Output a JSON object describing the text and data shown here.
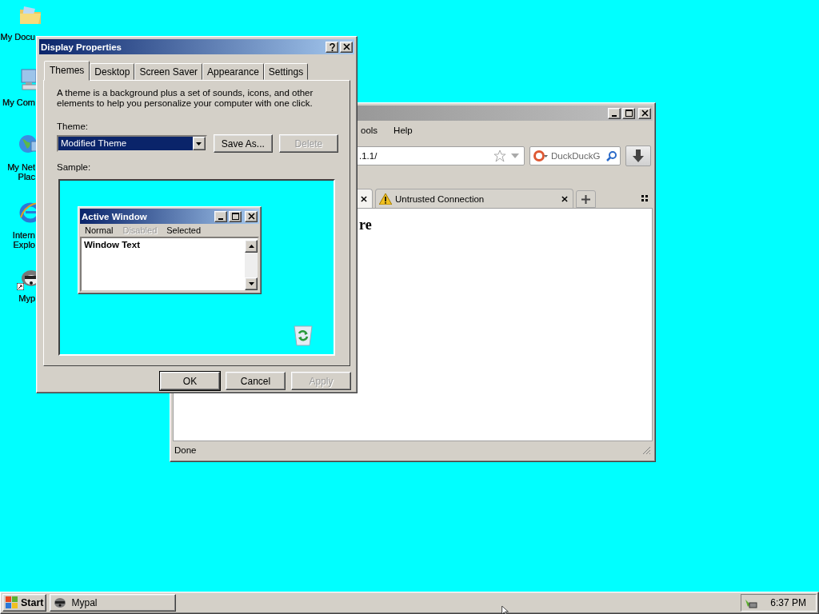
{
  "desktop": {
    "icons": [
      {
        "kind": "folder",
        "lines": [
          "My Docu"
        ]
      },
      {
        "kind": "computer",
        "lines": [
          "My Com"
        ]
      },
      {
        "kind": "network",
        "lines": [
          "My Net",
          "Plac"
        ]
      },
      {
        "kind": "explorer",
        "lines": [
          "Intern",
          "Explo"
        ]
      },
      {
        "kind": "raccoon",
        "lines": [
          "Myp"
        ],
        "shortcut": true
      }
    ]
  },
  "browser_window": {
    "menu": [
      "ools",
      "Help"
    ],
    "address": ".1.1/",
    "search_placeholder": "DuckDuckG",
    "tabs": [
      {
        "selected": true
      },
      {
        "label": "Untrusted Connection",
        "selected": false,
        "warning": true
      }
    ],
    "page_heading": "re",
    "status": "Done"
  },
  "dialog": {
    "title": "Display Properties",
    "tabs": [
      {
        "label": "Themes",
        "selected": true
      },
      {
        "label": "Desktop",
        "selected": false
      },
      {
        "label": "Screen Saver",
        "selected": false
      },
      {
        "label": "Appearance",
        "selected": false
      },
      {
        "label": "Settings",
        "selected": false
      }
    ],
    "description": "A theme is a background plus a set of sounds, icons, and other elements to help you personalize your computer with one click.",
    "theme_label": "Theme:",
    "theme_value": "Modified Theme",
    "theme_buttons": [
      {
        "label": "Save As...",
        "disabled": false
      },
      {
        "label": "Delete",
        "disabled": true
      }
    ],
    "sample_label": "Sample:",
    "sample_window": {
      "title": "Active Window",
      "menu": [
        {
          "label": "Normal",
          "disabled": false
        },
        {
          "label": "Disabled",
          "disabled": true
        },
        {
          "label": "Selected",
          "disabled": false
        }
      ],
      "text": "Window Text"
    },
    "buttons": [
      {
        "label": "OK",
        "disabled": false,
        "default": true
      },
      {
        "label": "Cancel",
        "disabled": false,
        "default": false
      },
      {
        "label": "Apply",
        "disabled": true,
        "default": false
      }
    ]
  },
  "taskbar": {
    "start": "Start",
    "tasks": [
      {
        "label": "Mypal"
      }
    ],
    "clock": "6:37 PM"
  }
}
